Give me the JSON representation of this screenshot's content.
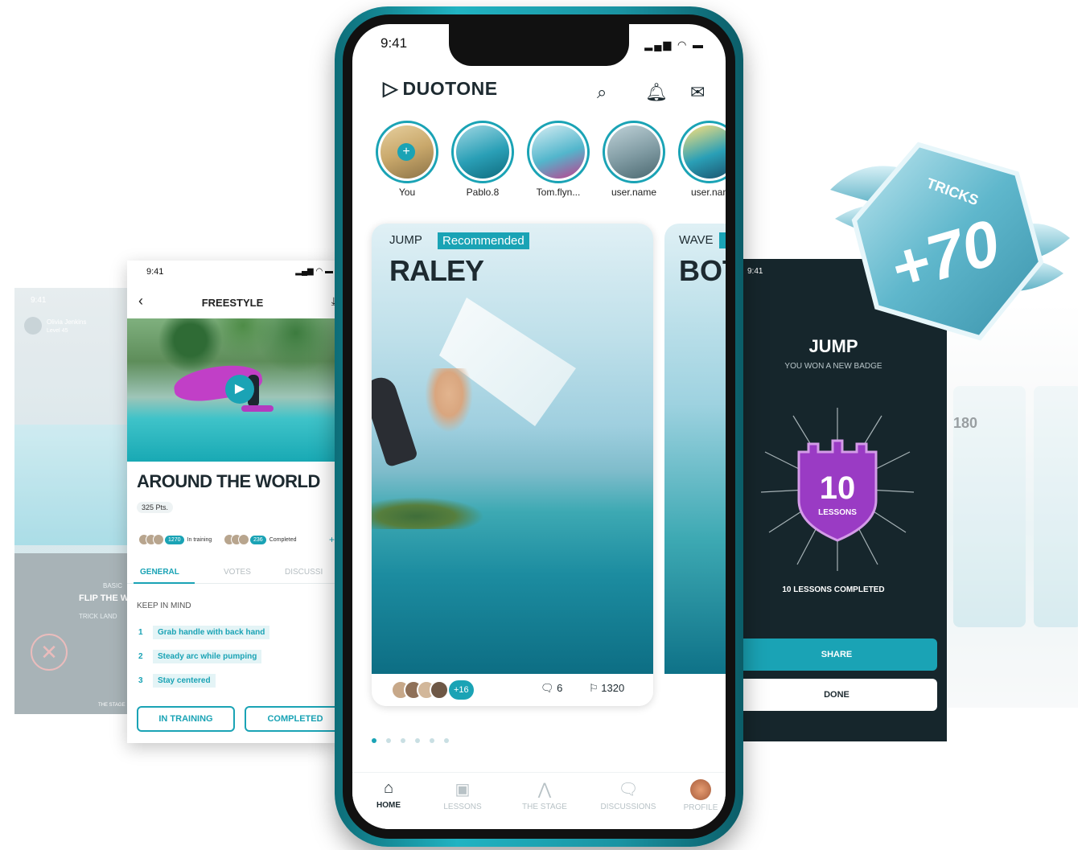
{
  "colors": {
    "accent": "#1aa3b5",
    "dark": "#1d2a30",
    "dark_panel": "#16262c",
    "badge_purple": "#9a3bc4"
  },
  "far_left": {
    "time": "9:41",
    "user": "Olivia Jenkins",
    "level": "Level 45",
    "basic": "BASIC",
    "trick": "FLIP THE W",
    "landed": "TRICK LAND",
    "stage": "THE STAGE"
  },
  "left_screen": {
    "time": "9:41",
    "title": "FREESTYLE",
    "heading": "AROUND THE WORLD",
    "points": "325 Pts.",
    "in_training_count": "1270",
    "in_training_label": "In training",
    "completed_count": "236",
    "completed_label": "Completed",
    "tabs": [
      "GENERAL",
      "VOTES",
      "DISCUSSI"
    ],
    "keep_in_mind": "KEEP IN MIND",
    "tips": [
      {
        "num": "1",
        "text": "Grab handle with back hand"
      },
      {
        "num": "2",
        "text": "Steady arc while pumping"
      },
      {
        "num": "3",
        "text": "Stay centered"
      }
    ],
    "btn_training": "IN TRAINING",
    "btn_completed": "COMPLETED"
  },
  "phone": {
    "time": "9:41",
    "brand": "DUOTONE",
    "stories": [
      "You",
      "Pablo.8",
      "Tom.flyn...",
      "user.name",
      "user.nan"
    ],
    "card1": {
      "category": "JUMP",
      "tag": "Recommended",
      "trick": "RALEY",
      "more": "+16",
      "comments": "6",
      "flags": "1320"
    },
    "card2": {
      "category": "WAVE",
      "trick": "BOT"
    },
    "nav": [
      "HOME",
      "LESSONS",
      "THE STAGE",
      "DISCUSSIONS",
      "PROFILE"
    ]
  },
  "right_screen": {
    "time": "9:41",
    "heading": "JUMP",
    "subtitle": "YOU WON A NEW BADGE",
    "badge_number": "10",
    "badge_label": "LESSONS",
    "completed_text": "10 LESSONS COMPLETED",
    "share": "SHARE",
    "done": "DONE"
  },
  "far_right": {
    "trick": "180"
  },
  "badge": {
    "label": "TRICKS",
    "value": "+70"
  }
}
